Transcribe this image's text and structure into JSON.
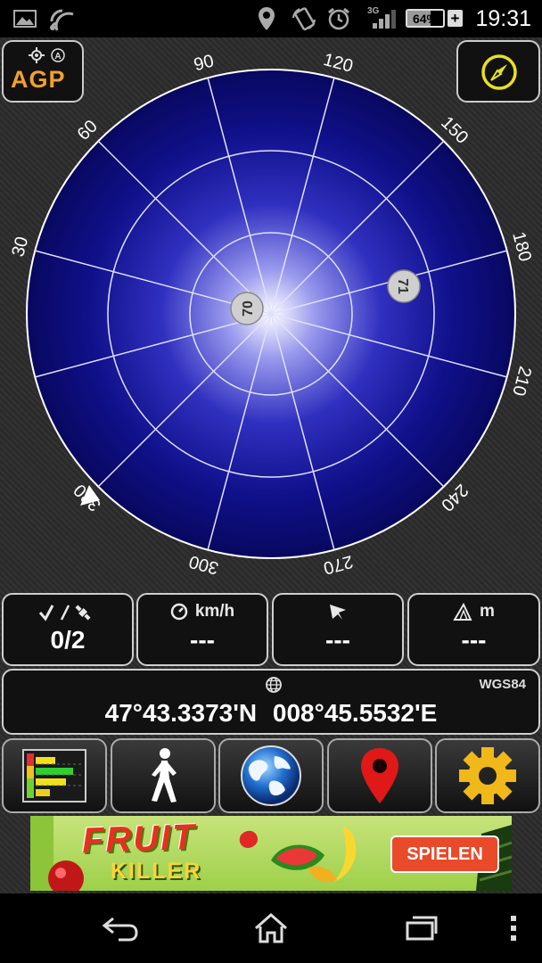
{
  "status_bar": {
    "network_type": "3G",
    "battery_percent": "64%",
    "battery_level": 0.64,
    "time": "19:31",
    "icons": [
      "image-icon",
      "signal-broadcast-icon",
      "location-pin-icon",
      "rotate-icon",
      "alarm-icon",
      "cell-signal-icon",
      "battery-icon",
      "charging-plus-icon"
    ]
  },
  "top": {
    "agp_label": "AGP",
    "compass_icon": "compass-icon"
  },
  "skyplot": {
    "azimuth_labels": [
      "30",
      "60",
      "90",
      "120",
      "150",
      "180",
      "210",
      "240",
      "270",
      "300",
      "330"
    ],
    "satellites": [
      {
        "id": "70"
      },
      {
        "id": "71"
      }
    ],
    "marker": "direction-triangle"
  },
  "info": {
    "satellites": {
      "value": "0/2",
      "icon": "satellite-check-icon"
    },
    "speed": {
      "unit": "km/h",
      "value": "---",
      "icon": "speedometer-icon"
    },
    "heading": {
      "value": "---",
      "icon": "heading-arrow-icon"
    },
    "altitude": {
      "unit": "m",
      "value": "---",
      "icon": "altitude-icon"
    }
  },
  "coordinates": {
    "datum": "WGS84",
    "text": "47°43.3373'N  008°45.5532'E",
    "icon": "globe-icon"
  },
  "toolbar": [
    "signal-bars-icon",
    "walking-person-icon",
    "earth-icon",
    "map-pin-icon",
    "settings-gear-icon"
  ],
  "ad": {
    "title": "FRUIT",
    "subtitle": "KILLER",
    "button": "SPIELEN"
  },
  "nav": [
    "back-icon",
    "home-icon",
    "recent-apps-icon",
    "menu-dots-icon"
  ]
}
